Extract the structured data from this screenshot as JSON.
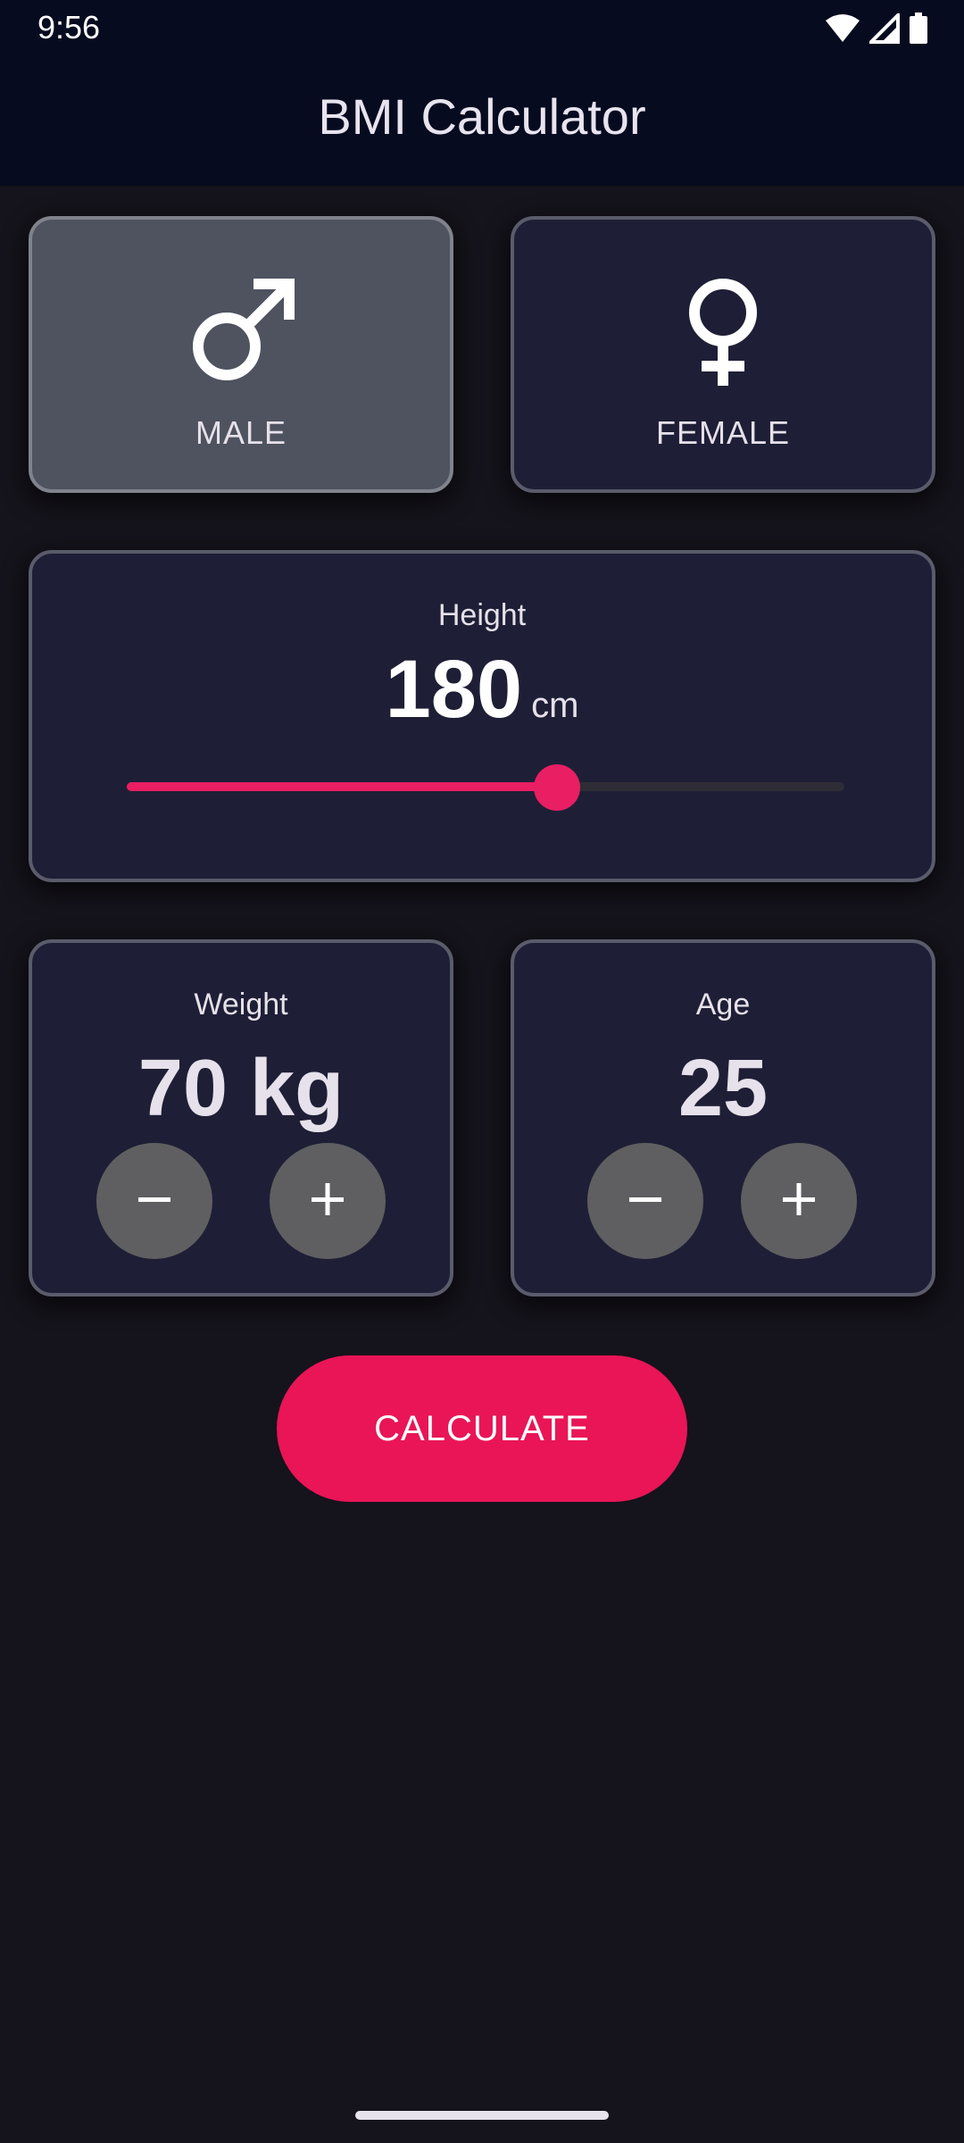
{
  "status_bar": {
    "time": "9:56",
    "icons": [
      "wifi-icon",
      "cellular-signal-icon",
      "battery-icon"
    ]
  },
  "app_bar": {
    "title": "BMI Calculator"
  },
  "gender": {
    "options": [
      {
        "label": "MALE",
        "icon": "male-symbol-icon",
        "selected": true
      },
      {
        "label": "FEMALE",
        "icon": "female-symbol-icon",
        "selected": false
      }
    ]
  },
  "height": {
    "label": "Height",
    "value": "180",
    "unit": "cm",
    "slider_fraction": 0.6
  },
  "weight": {
    "label": "Weight",
    "value_text": "70 kg",
    "decrement_icon": "minus-icon",
    "increment_icon": "plus-icon"
  },
  "age": {
    "label": "Age",
    "value_text": "25",
    "decrement_icon": "minus-icon",
    "increment_icon": "plus-icon"
  },
  "calculate_button": {
    "label": "CALCULATE"
  },
  "colors": {
    "accent": "#e91e63",
    "background": "#15131b",
    "card": "#1e1f36",
    "card_selected": "#4f5360",
    "app_bar": "#060b1f"
  }
}
